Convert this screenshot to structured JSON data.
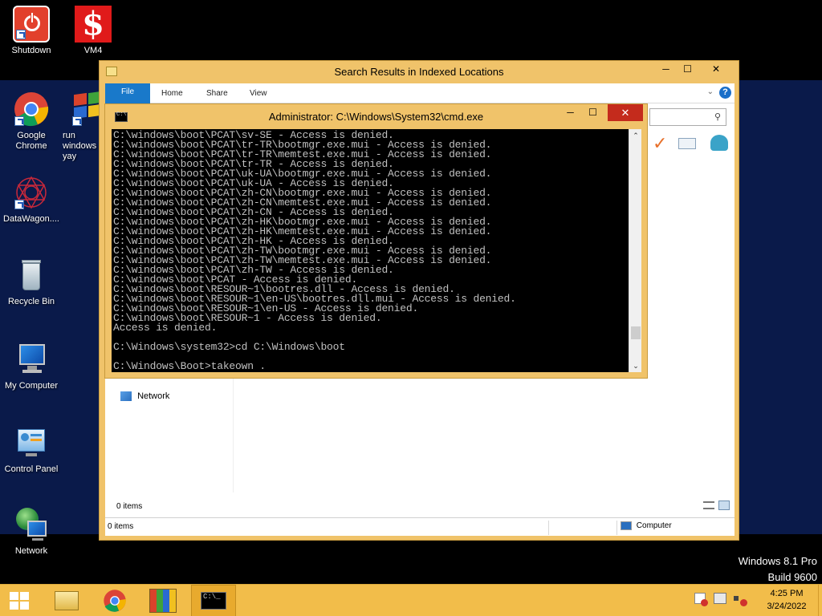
{
  "desktop": {
    "icons": [
      {
        "label": "Shutdown",
        "icon": "shutdown-icon"
      },
      {
        "label": "VM4",
        "icon": "vm4-icon"
      },
      {
        "label": "Google Chrome",
        "icon": "chrome-icon"
      },
      {
        "label": "run windows yay",
        "icon": "run-windows-icon"
      },
      {
        "label": "DataWagon....",
        "icon": "datawagon-icon"
      },
      {
        "label": "Recycle Bin",
        "icon": "recycle-bin-icon"
      },
      {
        "label": "My Computer",
        "icon": "my-computer-icon"
      },
      {
        "label": "Control Panel",
        "icon": "control-panel-icon"
      },
      {
        "label": "Network",
        "icon": "network-icon"
      }
    ],
    "watermark_line1": "Windows 8.1 Pro",
    "watermark_line2": "Build 9600"
  },
  "explorer": {
    "title": "Search Results in Indexed Locations",
    "ribbon_tabs": [
      "File",
      "Home",
      "Share",
      "View"
    ],
    "nav_network": "Network",
    "items_count": "0 items",
    "status_left": "0 items",
    "status_right": "Computer"
  },
  "cmd": {
    "title": "Administrator: C:\\Windows\\System32\\cmd.exe",
    "lines": [
      "C:\\windows\\boot\\PCAT\\sv-SE - Access is denied.",
      "C:\\windows\\boot\\PCAT\\tr-TR\\bootmgr.exe.mui - Access is denied.",
      "C:\\windows\\boot\\PCAT\\tr-TR\\memtest.exe.mui - Access is denied.",
      "C:\\windows\\boot\\PCAT\\tr-TR - Access is denied.",
      "C:\\windows\\boot\\PCAT\\uk-UA\\bootmgr.exe.mui - Access is denied.",
      "C:\\windows\\boot\\PCAT\\uk-UA - Access is denied.",
      "C:\\windows\\boot\\PCAT\\zh-CN\\bootmgr.exe.mui - Access is denied.",
      "C:\\windows\\boot\\PCAT\\zh-CN\\memtest.exe.mui - Access is denied.",
      "C:\\windows\\boot\\PCAT\\zh-CN - Access is denied.",
      "C:\\windows\\boot\\PCAT\\zh-HK\\bootmgr.exe.mui - Access is denied.",
      "C:\\windows\\boot\\PCAT\\zh-HK\\memtest.exe.mui - Access is denied.",
      "C:\\windows\\boot\\PCAT\\zh-HK - Access is denied.",
      "C:\\windows\\boot\\PCAT\\zh-TW\\bootmgr.exe.mui - Access is denied.",
      "C:\\windows\\boot\\PCAT\\zh-TW\\memtest.exe.mui - Access is denied.",
      "C:\\windows\\boot\\PCAT\\zh-TW - Access is denied.",
      "C:\\windows\\boot\\PCAT - Access is denied.",
      "C:\\windows\\boot\\RESOUR~1\\bootres.dll - Access is denied.",
      "C:\\windows\\boot\\RESOUR~1\\en-US\\bootres.dll.mui - Access is denied.",
      "C:\\windows\\boot\\RESOUR~1\\en-US - Access is denied.",
      "C:\\windows\\boot\\RESOUR~1 - Access is denied.",
      "Access is denied.",
      "",
      "C:\\Windows\\system32>cd C:\\Windows\\boot",
      "",
      "C:\\Windows\\Boot>takeown ."
    ]
  },
  "taskbar": {
    "clock_time": "4:25 PM",
    "clock_date": "3/24/2022",
    "pinned": [
      "file-explorer-icon",
      "chrome-icon",
      "windows-setup-icon",
      "cmd-icon"
    ]
  }
}
